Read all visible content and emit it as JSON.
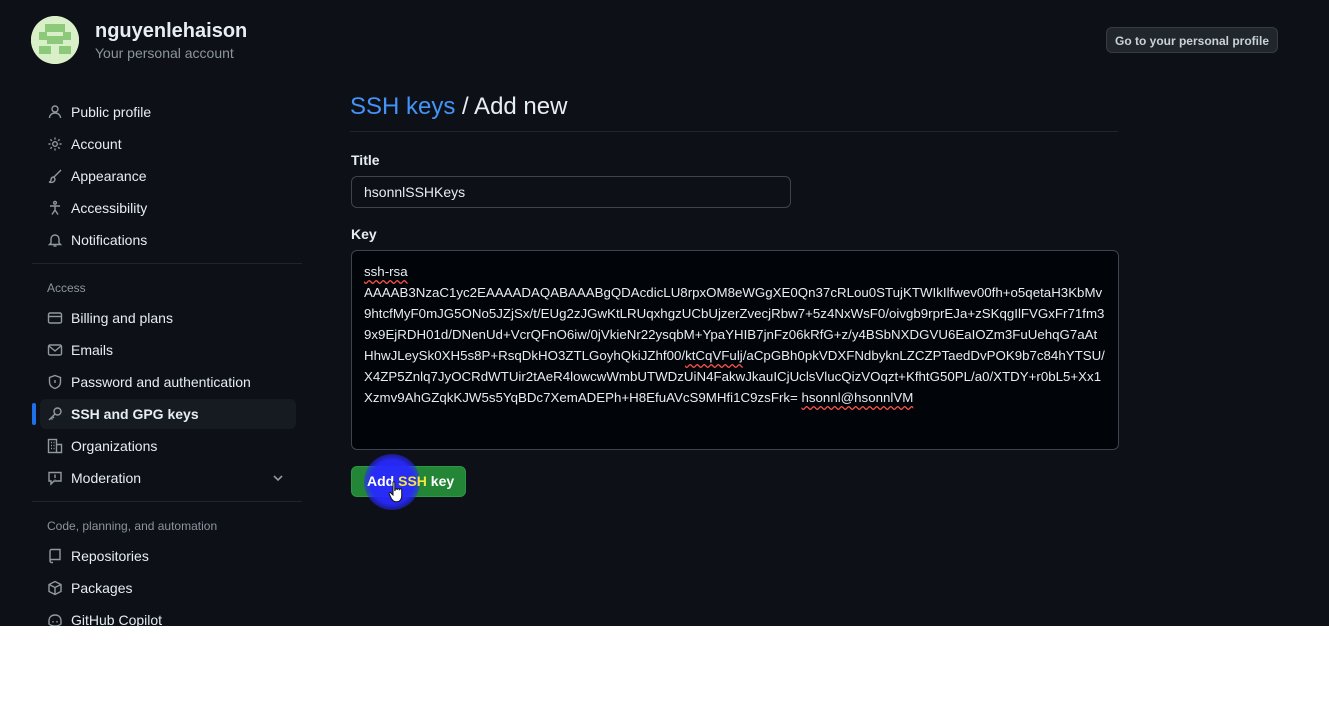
{
  "account": {
    "username": "nguyenlehaison",
    "subtitle": "Your personal account",
    "profile_button": "Go to your personal profile"
  },
  "sidebar": {
    "items": [
      {
        "label": "Public profile",
        "icon": "person-icon"
      },
      {
        "label": "Account",
        "icon": "gear-icon"
      },
      {
        "label": "Appearance",
        "icon": "paintbrush-icon"
      },
      {
        "label": "Accessibility",
        "icon": "accessibility-icon"
      },
      {
        "label": "Notifications",
        "icon": "bell-icon"
      }
    ],
    "access_label": "Access",
    "access_items": [
      {
        "label": "Billing and plans",
        "icon": "credit-card-icon"
      },
      {
        "label": "Emails",
        "icon": "mail-icon"
      },
      {
        "label": "Password and authentication",
        "icon": "shield-icon"
      },
      {
        "label": "SSH and GPG keys",
        "icon": "key-icon",
        "active": true
      },
      {
        "label": "Organizations",
        "icon": "organization-icon"
      },
      {
        "label": "Moderation",
        "icon": "report-icon",
        "expandable": true
      }
    ],
    "code_label": "Code, planning, and automation",
    "code_items": [
      {
        "label": "Repositories",
        "icon": "repo-icon"
      },
      {
        "label": "Packages",
        "icon": "package-icon"
      },
      {
        "label": "GitHub Copilot",
        "icon": "copilot-icon"
      }
    ]
  },
  "main": {
    "breadcrumb_link": "SSH keys",
    "breadcrumb_rest": " / Add new",
    "title_label": "Title",
    "title_value": "hsonnlSSHKeys",
    "key_label": "Key",
    "key_prefix": "ssh-rsa",
    "key_body": "AAAAB3NzaC1yc2EAAAADAQABAAABgQDAcdicLU8rpxOM8eWGgXE0Qn37cRLou0STujKTWIkIlfwev00fh+o5qetaH3KbMv9htcfMyF0mJG5ONo5JZjSx/t/EUg2zJGwKtLRUqxhgzUCbUjzerZvecjRbw7+5z4NxWsF0/oivgb9rprEJa+zSKqgIlFVGxFr71fm39x9EjRDH01d/DNenUd+VcrQFnO6iw/0jVkieNr22ysqbM+YpaYHIB7jnFz06kRfG+z/y4BSbNXDGVU6EaIOZm3FuUehqG7aAtHhwJLeySk0XH5s8P+RsqDkHO3ZTLGoyhQkiJZhf00/",
    "key_flag1": "ktCqVFulj",
    "key_body2": "/aCpGBh0pkVDXFNdbyknLZCZPTaedDvPOK9b7c84hYTSU/X4ZP5Znlq7JyOCRdWTUir2tAeR4lowcwWmbUTWDzUiN4FakwJkauICjUclsVlucQizVOqzt+KfhtG50PL/a0/XTDY+r0bL5+Xx1Xzmv9AhGZqkKJW5s5YqBDc7XemADEPh+H8EfuAVcS9MHfi1C9zsFrk= ",
    "key_comment": "hsonnl@hsonnlVM",
    "add_button": {
      "part1": "Add ",
      "part2": "SSH",
      "part3": " key"
    }
  },
  "colors": {
    "background": "#0d1117",
    "link": "#4493f8",
    "primary_button": "#238636",
    "active_indicator": "#1f6feb"
  }
}
